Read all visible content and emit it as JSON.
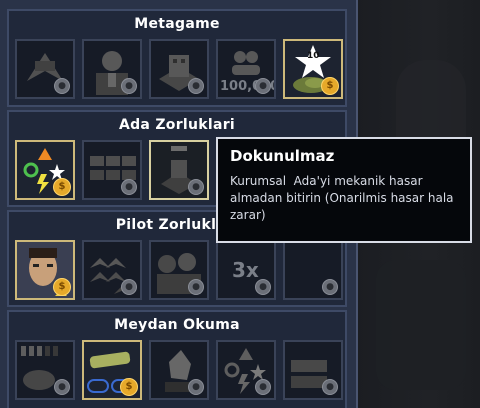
{
  "sections": [
    {
      "title": "Metagame",
      "tiles": [
        {
          "icon": "mech-silhouette-icon",
          "state": "locked"
        },
        {
          "icon": "pilot-portrait-icon",
          "state": "locked"
        },
        {
          "icon": "building-icon",
          "state": "locked"
        },
        {
          "icon": "people-icon",
          "state": "locked",
          "text": "100,000"
        },
        {
          "icon": "star-badge-icon",
          "state": "unlocked",
          "badge": "10"
        }
      ]
    },
    {
      "title": "Ada Zorluklari",
      "tiles": [
        {
          "icon": "symbols-icon",
          "state": "unlocked"
        },
        {
          "icon": "crates-icon",
          "state": "locked"
        },
        {
          "icon": "damaged-island-icon",
          "state": "selected"
        },
        {
          "icon": "hidden-tile",
          "state": "locked"
        },
        {
          "icon": "hidden-tile",
          "state": "locked"
        }
      ]
    },
    {
      "title": "Pilot Zorluklari",
      "tiles": [
        {
          "icon": "pilot-face-icon",
          "state": "unlocked"
        },
        {
          "icon": "chevron-stack-icon",
          "state": "locked"
        },
        {
          "icon": "pilot-group-icon",
          "state": "locked"
        },
        {
          "icon": "multiplier-icon",
          "state": "locked",
          "text": "3x"
        },
        {
          "icon": "dark-tile",
          "state": "locked"
        }
      ]
    },
    {
      "title": "Meydan Okuma",
      "tiles": [
        {
          "icon": "grid-bars-icon",
          "state": "locked"
        },
        {
          "icon": "arm-icon",
          "state": "unlocked"
        },
        {
          "icon": "rock-icon",
          "state": "locked"
        },
        {
          "icon": "symbols-icon",
          "state": "locked"
        },
        {
          "icon": "cannon-icon",
          "state": "locked"
        }
      ]
    }
  ],
  "tooltip": {
    "title": "Dokunulmaz",
    "body": "Kurumsal  Ada'yi mekanik hasar almadan bitirin (Onarilmis hasar hala zarar)"
  },
  "colors": {
    "panel": "#2a3348",
    "section": "#20283a",
    "gold": "#e6a92a",
    "unlocked_border": "#cdb97a"
  }
}
